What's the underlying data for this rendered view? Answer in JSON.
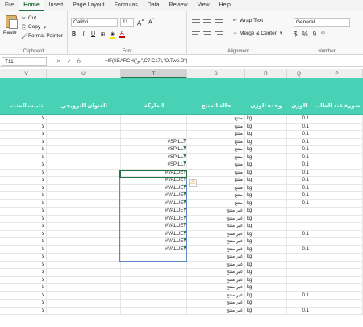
{
  "tabs": [
    "File",
    "Home",
    "Insert",
    "Page Layout",
    "Formulas",
    "Data",
    "Review",
    "View",
    "Help"
  ],
  "active_tab": "Home",
  "ribbon": {
    "clipboard": {
      "paste": "Paste",
      "cut": "Cut",
      "copy": "Copy",
      "format_painter": "Format Painter",
      "label": "Clipboard"
    },
    "font": {
      "name": "Calibri",
      "size": "11",
      "label": "Font"
    },
    "alignment": {
      "wrap": "Wrap Text",
      "merge": "Merge & Center",
      "label": "Alignment"
    },
    "number": {
      "format": "General",
      "label": "Number",
      "currency": "$",
      "percent": "%",
      "comma": "9"
    }
  },
  "formula_bar": {
    "name_box": "T11",
    "formula": "=IF(SEARCH(\"نو\",C7:C17),\"O.Two.O\")"
  },
  "columns": [
    "V",
    "U",
    "T",
    "S",
    "R",
    "Q",
    "P"
  ],
  "headers": {
    "v": "تثبيت المنت",
    "u": "العنوان الترويجي",
    "t": "الماركة",
    "s": "حالة المنتج",
    "r": "وحدة الوزن",
    "q": "الوزن",
    "p": "صورة عند الطلب"
  },
  "rows": [
    {
      "v": "لا",
      "t": "",
      "s": "منتج",
      "r": "kg",
      "q": "0.1"
    },
    {
      "v": "لا",
      "t": "",
      "s": "منتج",
      "r": "kg",
      "q": "0.1"
    },
    {
      "v": "لا",
      "t": "",
      "s": "منتج",
      "r": "kg",
      "q": "0.1"
    },
    {
      "v": "لا",
      "t": "#SPILL!",
      "s": "منتج",
      "r": "kg",
      "q": "0.1"
    },
    {
      "v": "لا",
      "t": "#SPILL!",
      "s": "منتج",
      "r": "kg",
      "q": "0.1"
    },
    {
      "v": "لا",
      "t": "#SPILL!",
      "s": "منتج",
      "r": "kg",
      "q": "0.1"
    },
    {
      "v": "لا",
      "t": "#SPILL!",
      "s": "منتج",
      "r": "kg",
      "q": "0.1"
    },
    {
      "v": "لا",
      "t": "#VALUE!",
      "s": "منتج",
      "r": "kg",
      "q": "0.1"
    },
    {
      "v": "لا",
      "t": "#VALUE!",
      "s": "منتج",
      "r": "kg",
      "q": "0.1"
    },
    {
      "v": "لا",
      "t": "#VALUE!",
      "s": "منتج",
      "r": "kg",
      "q": "0.1"
    },
    {
      "v": "لا",
      "t": "#VALUE!",
      "s": "منتج",
      "r": "kg",
      "q": "0.1"
    },
    {
      "v": "لا",
      "t": "#VALUE!",
      "s": "منتج",
      "r": "kg",
      "q": "0.1"
    },
    {
      "v": "لا",
      "t": "#VALUE!",
      "s": "غير منتج",
      "r": "kg",
      "q": ""
    },
    {
      "v": "لا",
      "t": "#VALUE!",
      "s": "غير منتج",
      "r": "kg",
      "q": ""
    },
    {
      "v": "لا",
      "t": "#VALUE!",
      "s": "غير منتج",
      "r": "kg",
      "q": ""
    },
    {
      "v": "لا",
      "t": "#VALUE!",
      "s": "غير منتج",
      "r": "kg",
      "q": "0.1"
    },
    {
      "v": "لا",
      "t": "#VALUE!",
      "s": "غير منتج",
      "r": "kg",
      "q": ""
    },
    {
      "v": "لا",
      "t": "#VALUE!",
      "s": "غير منتج",
      "r": "kg",
      "q": "0.1"
    },
    {
      "v": "لا",
      "t": "",
      "s": "غير منتج",
      "r": "kg",
      "q": ""
    },
    {
      "v": "لا",
      "t": "",
      "s": "غير منتج",
      "r": "kg",
      "q": ""
    },
    {
      "v": "لا",
      "t": "",
      "s": "غير منتج",
      "r": "kg",
      "q": ""
    },
    {
      "v": "لا",
      "t": "",
      "s": "غير منتج",
      "r": "kg",
      "q": ""
    },
    {
      "v": "لا",
      "t": "",
      "s": "غير منتج",
      "r": "kg",
      "q": ""
    },
    {
      "v": "لا",
      "t": "",
      "s": "غير منتج",
      "r": "kg",
      "q": "0.1"
    },
    {
      "v": "لا",
      "t": "",
      "s": "غير منتج",
      "r": "kg",
      "q": ""
    },
    {
      "v": "لا",
      "t": "",
      "s": "غير منتج",
      "r": "kg",
      "q": "0.1"
    }
  ],
  "colors": {
    "header_bg": "#48d1b4",
    "accent": "#217346"
  }
}
